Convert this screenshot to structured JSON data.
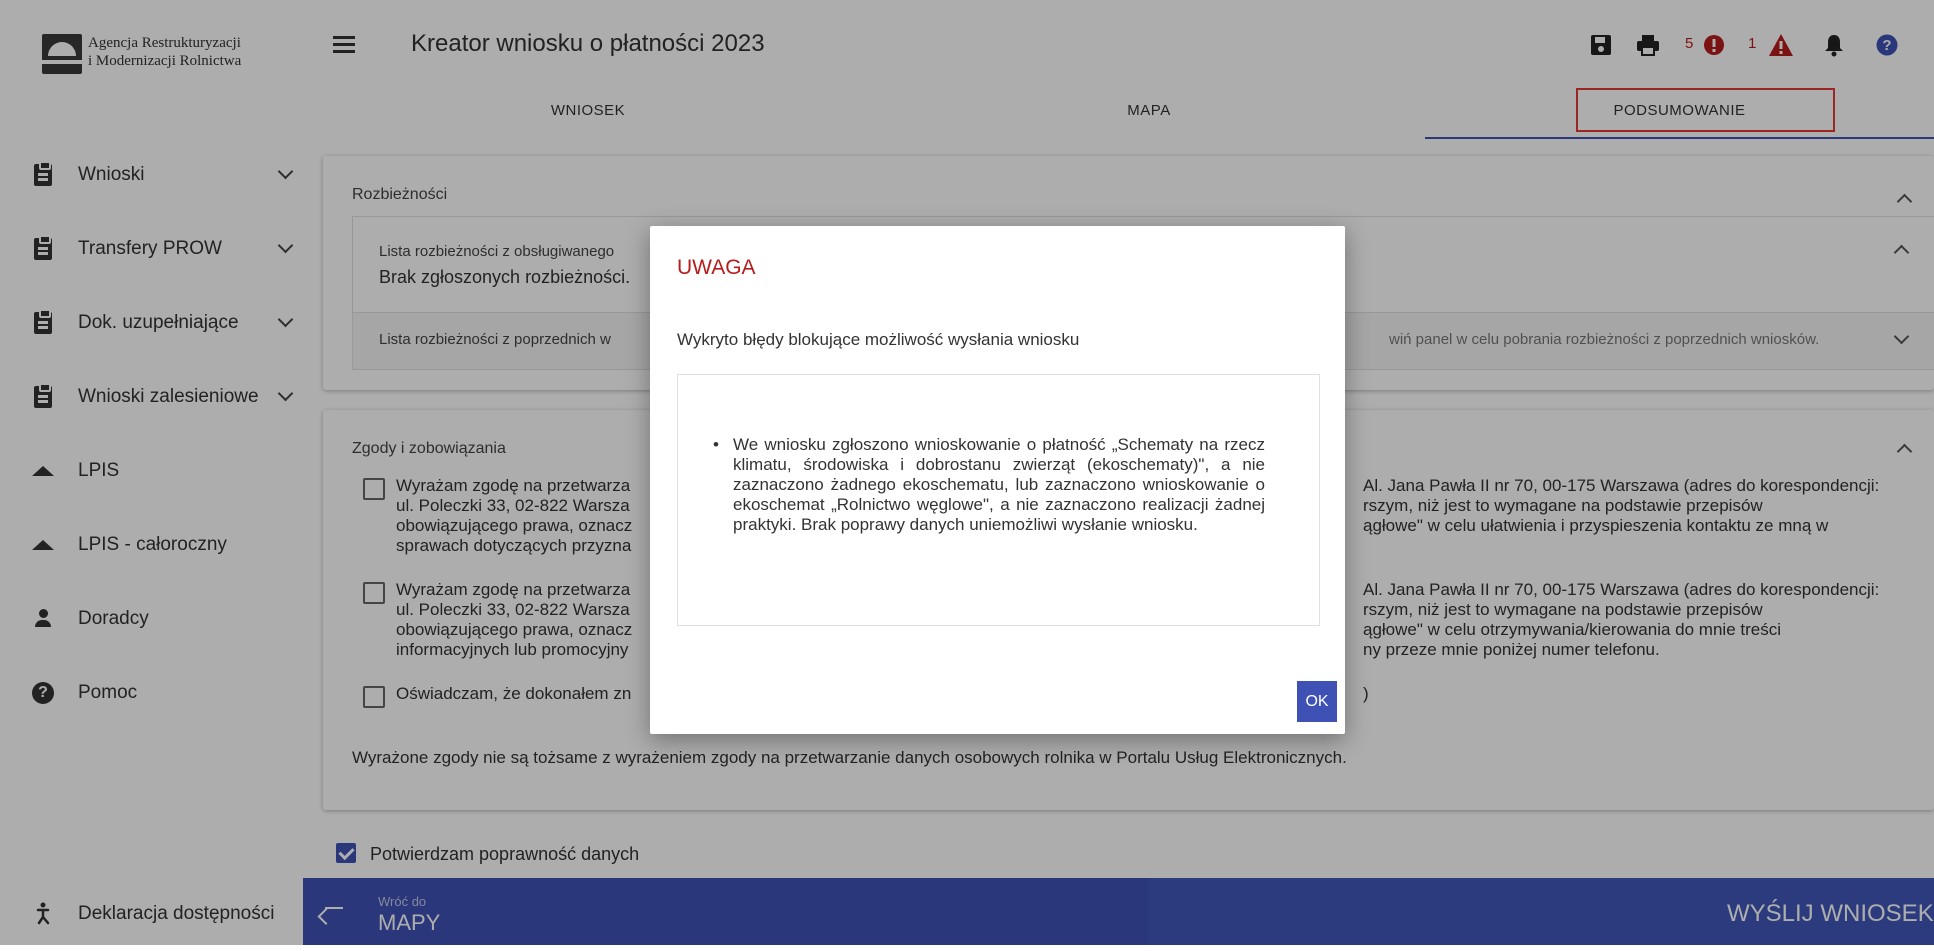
{
  "sidebar": {
    "logo": {
      "line1": "Agencja Restrukturyzacji",
      "line2": "i Modernizacji Rolnictwa"
    },
    "items": [
      {
        "label": "Wnioski",
        "icon": "clipboard-icon",
        "expandable": true
      },
      {
        "label": "Transfery PROW",
        "icon": "clipboard-icon",
        "expandable": true
      },
      {
        "label": "Dok. uzupełniające",
        "icon": "clipboard-icon",
        "expandable": true
      },
      {
        "label": "Wnioski zalesieniowe",
        "icon": "clipboard-icon",
        "expandable": true
      },
      {
        "label": "LPIS",
        "icon": "mountain-icon",
        "expandable": false
      },
      {
        "label": "LPIS - całoroczny",
        "icon": "mountain-icon",
        "expandable": false
      },
      {
        "label": "Doradcy",
        "icon": "person-icon",
        "expandable": false
      },
      {
        "label": "Pomoc",
        "icon": "help-icon",
        "expandable": false
      }
    ],
    "accessibility": "Deklaracja dostępności"
  },
  "header": {
    "title": "Kreator wniosku o płatności 2023",
    "error_count": "5",
    "warning_count": "1",
    "icons": [
      "save-icon",
      "print-icon",
      "error-icon",
      "warning-icon",
      "bell-icon",
      "help-icon"
    ]
  },
  "tabs": [
    "WNIOSEK",
    "MAPA",
    "PODSUMOWANIE"
  ],
  "active_tab": "PODSUMOWANIE",
  "discrepancies": {
    "title": "Rozbieżności",
    "current_label": "Lista rozbieżności z obsługiwanego",
    "current_value": "Brak zgłoszonych rozbieżności.",
    "previous_label": "Lista rozbieżności z poprzednich w",
    "previous_hint": "wiń panel w celu pobrania rozbieżności z poprzednich wniosków."
  },
  "consents": {
    "title": "Zgody i zobowiązania",
    "item1_left": [
      "Wyrażam zgodę na przetwarza",
      "ul. Poleczki 33, 02-822 Warsza",
      "obowiązującego prawa, oznacz",
      "sprawach dotyczących przyzna"
    ],
    "item1_right": [
      "Al. Jana Pawła II nr 70, 00-175 Warszawa (adres do korespondencji:",
      "rszym, niż jest to wymagane na podstawie przepisów",
      "ągłowe\" w celu ułatwienia i przyspieszenia kontaktu ze mną w"
    ],
    "item2_left": [
      "Wyrażam zgodę na przetwarza",
      "ul. Poleczki 33, 02-822 Warsza",
      "obowiązującego prawa, oznacz",
      "informacyjnych lub promocyjny"
    ],
    "item2_right": [
      "Al. Jana Pawła II nr 70, 00-175 Warszawa (adres do korespondencji:",
      "rszym, niż jest to wymagane na podstawie przepisów",
      "ągłowe\" w celu otrzymywania/kierowania do mnie treści",
      "ny przeze mnie poniżej numer telefonu."
    ],
    "item3_left": "Oświadczam, że dokonałem zn",
    "item3_right": ")",
    "note": "Wyrażone zgody nie są tożsame z wyrażeniem zgody na przetwarzanie danych osobowych rolnika w Portalu Usług Elektronicznych."
  },
  "confirm": {
    "label": "Potwierdzam poprawność danych",
    "checked": true
  },
  "footer": {
    "back_small": "Wróć do",
    "back_big": "MAPY",
    "send": "WYŚLIJ WNIOSEK"
  },
  "dialog": {
    "title": "UWAGA",
    "message": "Wykryto błędy blokujące możliwość wysłania wniosku",
    "bullet": "We wniosku zgłoszono wnioskowanie o płatność „Schematy na rzecz klimatu, środowiska i dobrostanu zwierząt (ekoschematy)\", a nie zaznaczono żadnego ekoschematu, lub zaznaczono wnioskowanie o ekoschemat „Rolnictwo węglowe\", a nie zaznaczono realizacji żadnej praktyki. Brak poprawy danych uniemożliwi wysłanie wniosku.",
    "ok": "OK"
  },
  "colors": {
    "primary": "#3f51b5",
    "danger": "#b71c1c",
    "highlight_border": "#e53935"
  }
}
